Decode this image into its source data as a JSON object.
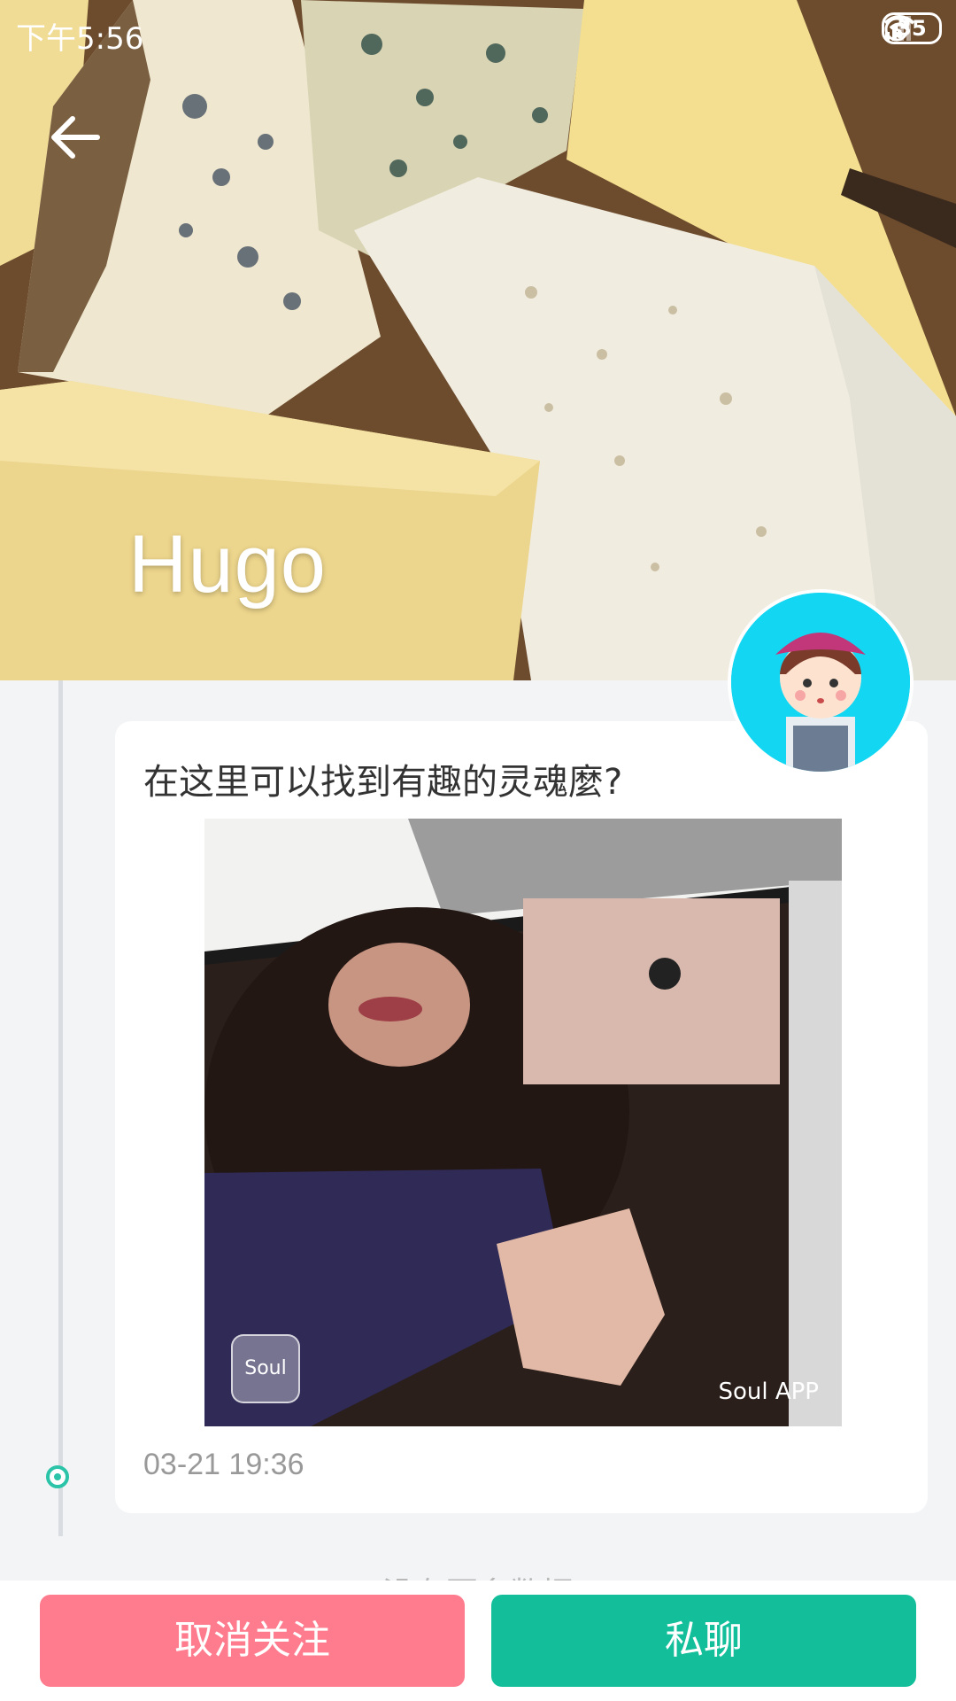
{
  "status_bar": {
    "time": "下午5:56",
    "battery": "35",
    "icons": [
      "alarm-icon",
      "hd-signal-icon",
      "wifi-icon",
      "battery-icon"
    ]
  },
  "header": {
    "back_icon": "arrow-left-icon",
    "username": "Hugo",
    "cover_description_icon": "cheese-cover-image"
  },
  "post": {
    "text": "在这里可以找到有趣的灵魂麼?",
    "image_watermark_logo": "Soul",
    "image_watermark_text": "Soul APP",
    "timestamp": "03-21 19:36"
  },
  "footer_note": "没有更多数据",
  "actions": {
    "unfollow_label": "取消关注",
    "chat_label": "私聊"
  },
  "colors": {
    "unfollow": "#ff7b8e",
    "chat": "#13bf9b",
    "avatar_bg": "#12d6f2",
    "timeline_dot": "#2bc4a9"
  }
}
